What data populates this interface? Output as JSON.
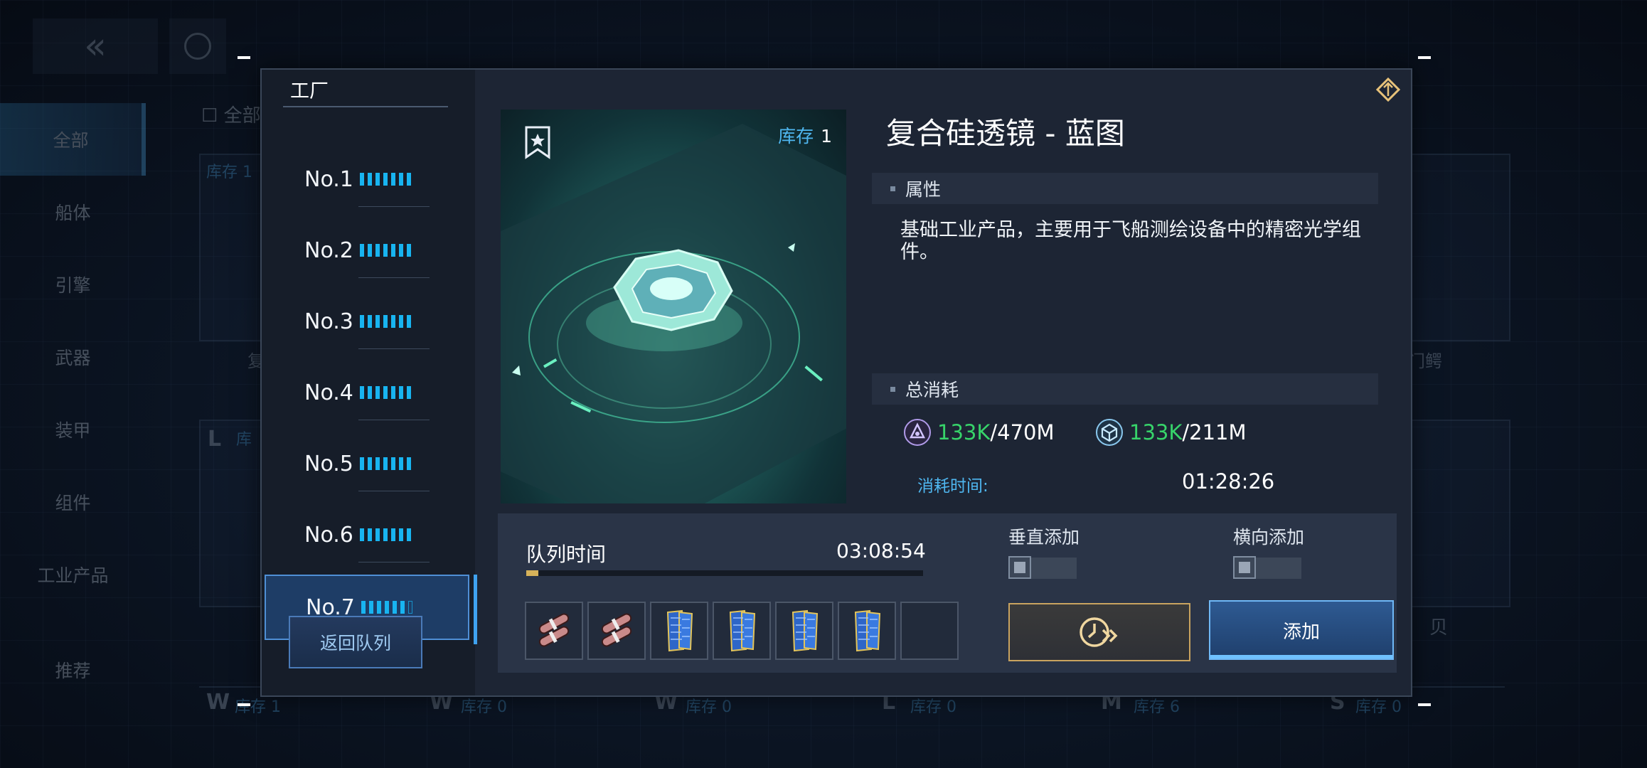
{
  "background": {
    "back_icon": "double-chevron-left-icon",
    "sidebar": [
      "全部",
      "船体",
      "引擎",
      "武器",
      "装甲",
      "组件",
      "工业产品",
      "推荐"
    ],
    "check_label": "全部",
    "card_stock_top": "库存 1",
    "card_label_partial": "复",
    "card_label_right": "门鳄",
    "row_tags": [
      {
        "tag": "L",
        "text": "库"
      },
      {
        "tag": "W",
        "text": "库存 1"
      },
      {
        "tag": "W",
        "text": "库存 0"
      },
      {
        "tag": "W",
        "text": "库存 0"
      },
      {
        "tag": "L",
        "text": "库存 0"
      },
      {
        "tag": "M",
        "text": "库存 6"
      },
      {
        "tag": "S",
        "text": "库存 0"
      }
    ],
    "right_partial": "贝"
  },
  "factory": {
    "title": "工厂",
    "slots": [
      {
        "name": "No.1",
        "filled": 7,
        "total": 7
      },
      {
        "name": "No.2",
        "filled": 7,
        "total": 7
      },
      {
        "name": "No.3",
        "filled": 7,
        "total": 7
      },
      {
        "name": "No.4",
        "filled": 7,
        "total": 7
      },
      {
        "name": "No.5",
        "filled": 7,
        "total": 7
      },
      {
        "name": "No.6",
        "filled": 7,
        "total": 7
      },
      {
        "name": "No.7",
        "filled": 6,
        "total": 7
      }
    ],
    "active_slot": "No.7",
    "return_label": "返回队列"
  },
  "item": {
    "title": "复合硅透镜 - 蓝图",
    "stock_label": "库存",
    "stock_value": "1",
    "bookmark_icon": "star-bookmark-icon",
    "attr_heading": "属性",
    "description": "基础工业产品，主要用于飞船测绘设备中的精密光学组件。",
    "cost_heading": "总消耗",
    "costs": [
      {
        "icon": "purple-crystal-icon",
        "have": "133K",
        "need": "/470M"
      },
      {
        "icon": "blue-cube-icon",
        "have": "133K",
        "need": "/211M"
      }
    ],
    "time_label": "消耗时间:",
    "time_value": "01:28:26"
  },
  "queue": {
    "label": "队列时间",
    "time": "03:08:54",
    "progress": 0.03,
    "vertical_add": "垂直添加",
    "horizontal_add": "横向添加",
    "items": [
      "red-cylinders-icon",
      "red-cylinders-icon",
      "blue-panel-icon",
      "blue-panel-icon",
      "blue-panel-icon",
      "blue-panel-icon",
      "empty"
    ],
    "speedup_icon": "clock-fast-forward-icon",
    "add_label": "添加"
  },
  "colors": {
    "accent": "#18b4f0",
    "have": "#37d46a",
    "gold": "#c9a35f"
  }
}
